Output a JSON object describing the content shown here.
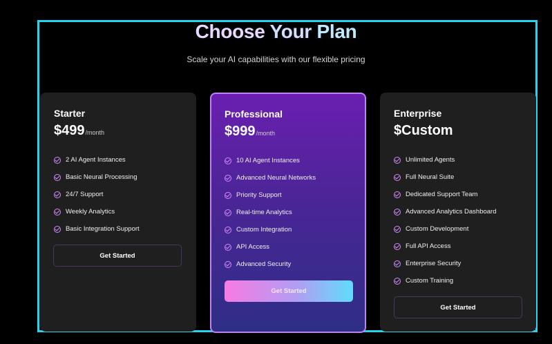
{
  "header": {
    "title_words": [
      "Choose",
      "Your",
      "Plan"
    ],
    "subtitle": "Scale your AI capabilities with our flexible pricing"
  },
  "plans": [
    {
      "name": "Starter",
      "price": "$499",
      "period": "/month",
      "features": [
        "2 AI Agent Instances",
        "Basic Neural Processing",
        "24/7 Support",
        "Weekly Analytics",
        "Basic Integration Support"
      ],
      "button": "Get Started"
    },
    {
      "name": "Professional",
      "price": "$999",
      "period": "/month",
      "features": [
        "10 AI Agent Instances",
        "Advanced Neural Networks",
        "Priority Support",
        "Real-time Analytics",
        "Custom Integration",
        "API Access",
        "Advanced Security"
      ],
      "button": "Get Started"
    },
    {
      "name": "Enterprise",
      "price": "$Custom",
      "period": "",
      "features": [
        "Unlimited Agents",
        "Full Neural Suite",
        "Dedicated Support Team",
        "Advanced Analytics Dashboard",
        "Custom Development",
        "Full API Access",
        "Enterprise Security",
        "Custom Training"
      ],
      "button": "Get Started"
    }
  ],
  "colors": {
    "frame_border": "#22d6f2",
    "card_background": "#1f1f1f",
    "check_accent": "#d48cff",
    "featured_gradient": [
      "#6a1fb0",
      "#2e2e86"
    ],
    "button_gradient": [
      "#f77be3",
      "#5fdcfb"
    ]
  },
  "icons": {
    "feature_check": "check-circle-icon"
  }
}
